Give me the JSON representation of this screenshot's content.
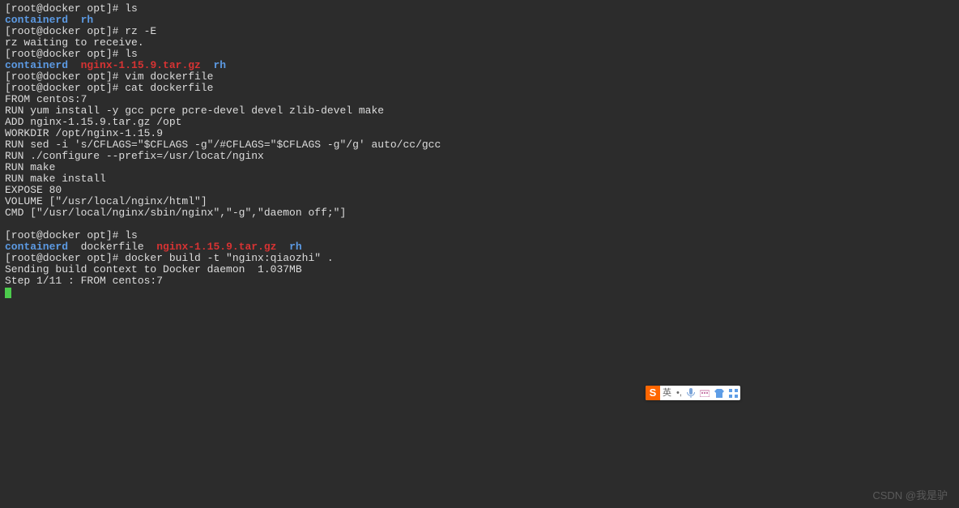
{
  "prompt1": "[root@docker opt]# ls",
  "dir1": "containerd",
  "dir2": "rh",
  "prompt2": "[root@docker opt]# rz -E",
  "rzwait": "rz waiting to receive.",
  "prompt3": "[root@docker opt]# ls",
  "ls2_dir1": "containerd",
  "ls2_tar": "nginx-1.15.9.tar.gz",
  "ls2_dir2": "rh",
  "prompt4": "[root@docker opt]# vim dockerfile",
  "prompt5": "[root@docker opt]# cat dockerfile",
  "df1": "FROM centos:7",
  "df2": "RUN yum install -y gcc pcre pcre-devel devel zlib-devel make",
  "df3": "ADD nginx-1.15.9.tar.gz /opt",
  "df4": "WORKDIR /opt/nginx-1.15.9",
  "df5": "RUN sed -i 's/CFLAGS=\"$CFLAGS -g\"/#CFLAGS=\"$CFLAGS -g\"/g' auto/cc/gcc",
  "df6": "RUN ./configure --prefix=/usr/locat/nginx",
  "df7": "RUN make",
  "df8": "RUN make install",
  "df9": "EXPOSE 80",
  "df10": "VOLUME [\"/usr/local/nginx/html\"]",
  "df11": "CMD [\"/usr/local/nginx/sbin/nginx\",\"-g\",\"daemon off;\"]",
  "prompt6": "[root@docker opt]# ls",
  "ls3_dir1": "containerd",
  "ls3_file": "dockerfile",
  "ls3_tar": "nginx-1.15.9.tar.gz",
  "ls3_dir2": "rh",
  "prompt7": "[root@docker opt]# docker build -t \"nginx:qiaozhi\" .",
  "build1": "Sending build context to Docker daemon  1.037MB",
  "build2": "Step 1/11 : FROM centos:7",
  "ime_logo": "S",
  "ime_lang": "英",
  "ime_punct": "•,",
  "watermark": "CSDN @我是驴"
}
